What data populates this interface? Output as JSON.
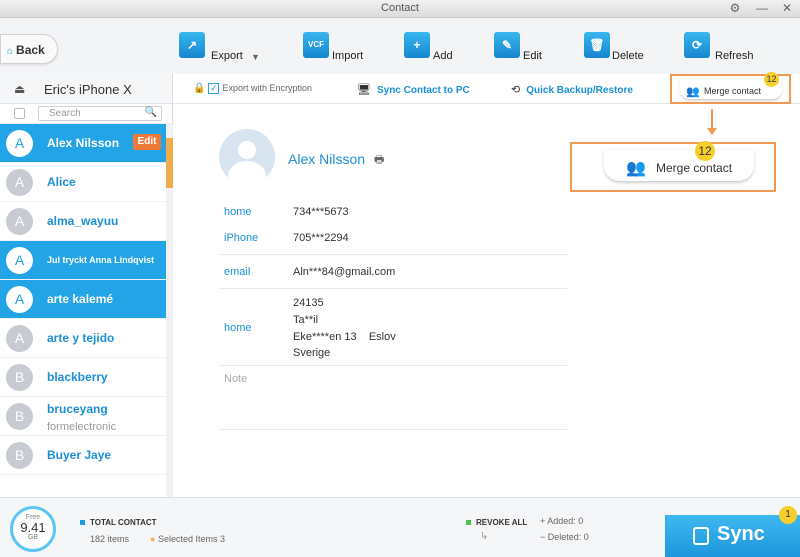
{
  "window": {
    "title": "Contact",
    "settings_icon": "⚙",
    "minimize": "—",
    "close": "✕"
  },
  "toolbar": {
    "back_label": "Back",
    "export_label": "Export",
    "import_label": "Import",
    "add_label": "Add",
    "edit_label": "Edit",
    "delete_label": "Delete",
    "refresh_label": "Refresh"
  },
  "sidebar": {
    "device_name": "Eric's iPhone X",
    "search_placeholder": "Search",
    "contacts": [
      {
        "initial": "A",
        "name": "Alex Nilsson",
        "sub": "",
        "selected": true
      },
      {
        "initial": "A",
        "name": "Alice",
        "sub": "",
        "selected": false
      },
      {
        "initial": "A",
        "name": "alma_wayuu",
        "sub": "",
        "selected": false
      },
      {
        "initial": "A",
        "name": "Jul tryckt Anna Lindqvist",
        "sub": "",
        "selected": true
      },
      {
        "initial": "A",
        "name": "arte kalemé",
        "sub": "",
        "selected": true
      },
      {
        "initial": "A",
        "name": "arte y tejido",
        "sub": "",
        "selected": false
      },
      {
        "initial": "B",
        "name": "blackberry",
        "sub": "",
        "selected": false
      },
      {
        "initial": "B",
        "name": "bruceyang",
        "sub": "formelectronic",
        "selected": false
      },
      {
        "initial": "B",
        "name": "Buyer Jaye",
        "sub": "",
        "selected": false
      }
    ],
    "edit_label": "Edit"
  },
  "subtoolbar": {
    "export_encryption": "Export with Encryption",
    "sync_pc": "Sync Contact to PC",
    "backup_restore": "Quick Backup/Restore",
    "merge_contact": "Merge contact",
    "merge_count": "12"
  },
  "detail": {
    "name": "Alex Nilsson",
    "fields": [
      {
        "label": "home",
        "value": "734***5673"
      },
      {
        "label": "iPhone",
        "value": "705***2294"
      },
      {
        "label": "email",
        "value": "Aln***84@gmail.com"
      }
    ],
    "address_label": "home",
    "address_lines": [
      "24135",
      "Ta**il",
      "Eke****en 13    Eslov",
      "Sverige"
    ],
    "note_label": "Note"
  },
  "status": {
    "storage_free_label": "Free",
    "storage_value": "9.41",
    "storage_unit": "GB",
    "total_contact_label": "TOTAL CONTACT",
    "items": "182 items",
    "selected_items": "Selected Items 3",
    "revoke_all": "REVOKE ALL",
    "added": "Added: 0",
    "deleted": "Deleted: 0",
    "sync_label": "Sync",
    "sync_badge": "1"
  },
  "colors": {
    "accent": "#1a8fd6",
    "selected_row": "#22a4e6",
    "highlight": "#ee9a55",
    "badge": "#f7cf2d"
  }
}
